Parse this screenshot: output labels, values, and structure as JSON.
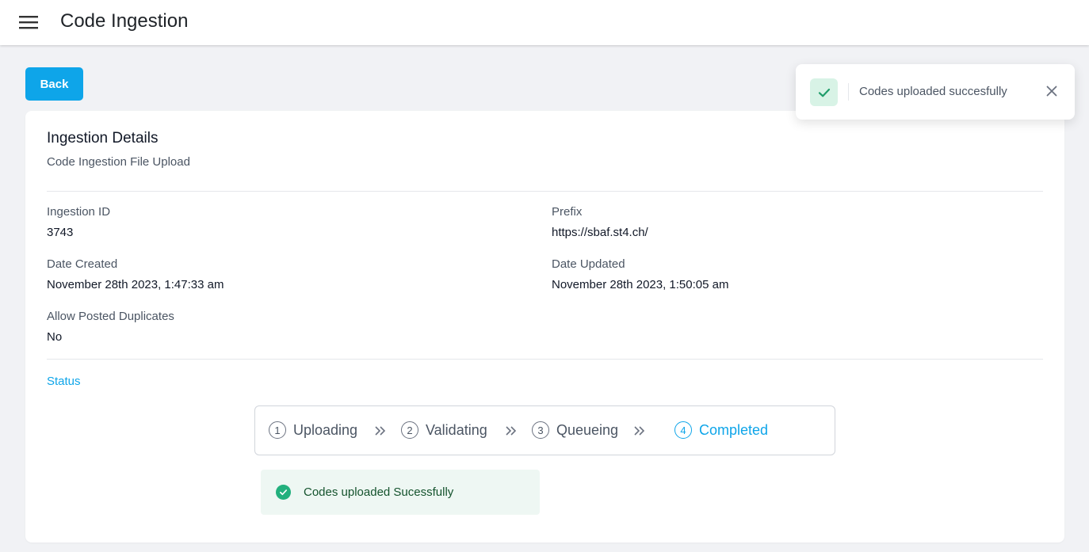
{
  "header": {
    "title": "Code Ingestion",
    "menu_icon": "hamburger-menu-icon"
  },
  "back_button": {
    "label": "Back",
    "color": "#0ea5e9"
  },
  "details": {
    "title": "Ingestion Details",
    "subtitle": "Code Ingestion File Upload",
    "fields": {
      "ingestion_id": {
        "label": "Ingestion ID",
        "value": "3743"
      },
      "prefix": {
        "label": "Prefix",
        "value": "https://sbaf.st4.ch/"
      },
      "date_created": {
        "label": "Date Created",
        "value": "November 28th 2023, 1:47:33 am"
      },
      "date_updated": {
        "label": "Date Updated",
        "value": "November 28th 2023, 1:50:05 am"
      },
      "allow_posted_duplicates": {
        "label": "Allow Posted Duplicates",
        "value": "No"
      }
    }
  },
  "status": {
    "heading": "Status",
    "steps": [
      {
        "number": "1",
        "label": "Uploading",
        "active": false
      },
      {
        "number": "2",
        "label": "Validating",
        "active": false
      },
      {
        "number": "3",
        "label": "Queueing",
        "active": false
      },
      {
        "number": "4",
        "label": "Completed",
        "active": true
      }
    ],
    "separator_icon": "double-chevron-right-icon",
    "alert": {
      "message": "Codes uploaded Sucessfully",
      "icon": "check-circle-icon",
      "color": "#22b07d"
    }
  },
  "toast": {
    "message": "Codes uploaded succesfully",
    "icon": "check-icon",
    "close_icon": "close-icon"
  },
  "colors": {
    "accent": "#0ea5e9",
    "success": "#22b07d",
    "background": "#f1f2f5"
  }
}
